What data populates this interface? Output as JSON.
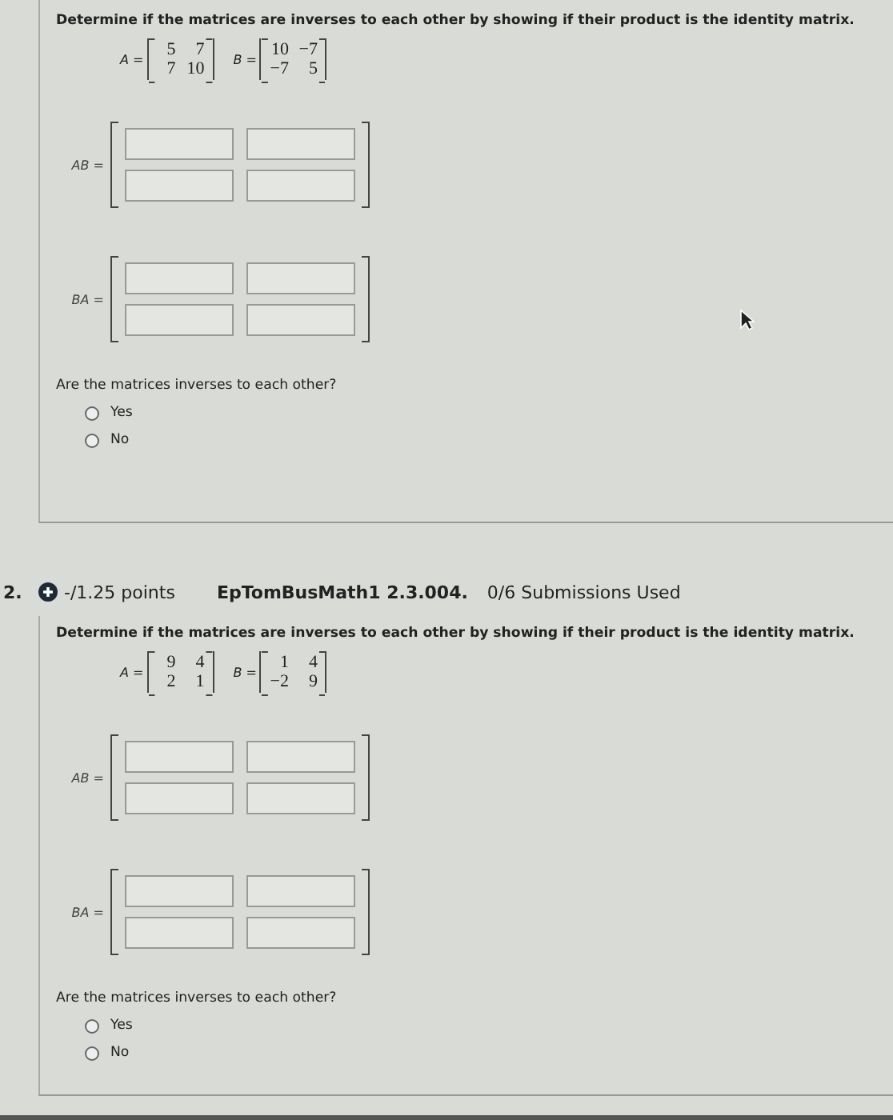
{
  "questions": [
    {
      "prompt": "Determine if the matrices are inverses to each other by showing if their product is the identity matrix.",
      "matrices": [
        {
          "name": "A =",
          "rows": [
            [
              "5",
              "7"
            ],
            [
              "7",
              "10"
            ]
          ]
        },
        {
          "name": "B =",
          "rows": [
            [
              "10",
              "−7"
            ],
            [
              "−7",
              "5"
            ]
          ]
        }
      ],
      "products": [
        {
          "label": "AB ="
        },
        {
          "label": "BA ="
        }
      ],
      "question": "Are the matrices inverses to each other?",
      "options": [
        {
          "label": "Yes",
          "selected": false
        },
        {
          "label": "No",
          "selected": false
        }
      ]
    },
    {
      "header": {
        "number": "2.",
        "points": "-/1.25 points",
        "code": "EpTomBusMath1 2.3.004.",
        "submissions": "0/6 Submissions Used"
      },
      "prompt": "Determine if the matrices are inverses to each other by showing if their product is the identity matrix.",
      "matrices": [
        {
          "name": "A =",
          "rows": [
            [
              "9",
              "4"
            ],
            [
              "2",
              "1"
            ]
          ]
        },
        {
          "name": "B =",
          "rows": [
            [
              "1",
              "4"
            ],
            [
              "−2",
              "9"
            ]
          ]
        }
      ],
      "products": [
        {
          "label": "AB ="
        },
        {
          "label": "BA ="
        }
      ],
      "question": "Are the matrices inverses to each other?",
      "options": [
        {
          "label": "Yes",
          "selected": false
        },
        {
          "label": "No",
          "selected": false
        }
      ]
    }
  ]
}
